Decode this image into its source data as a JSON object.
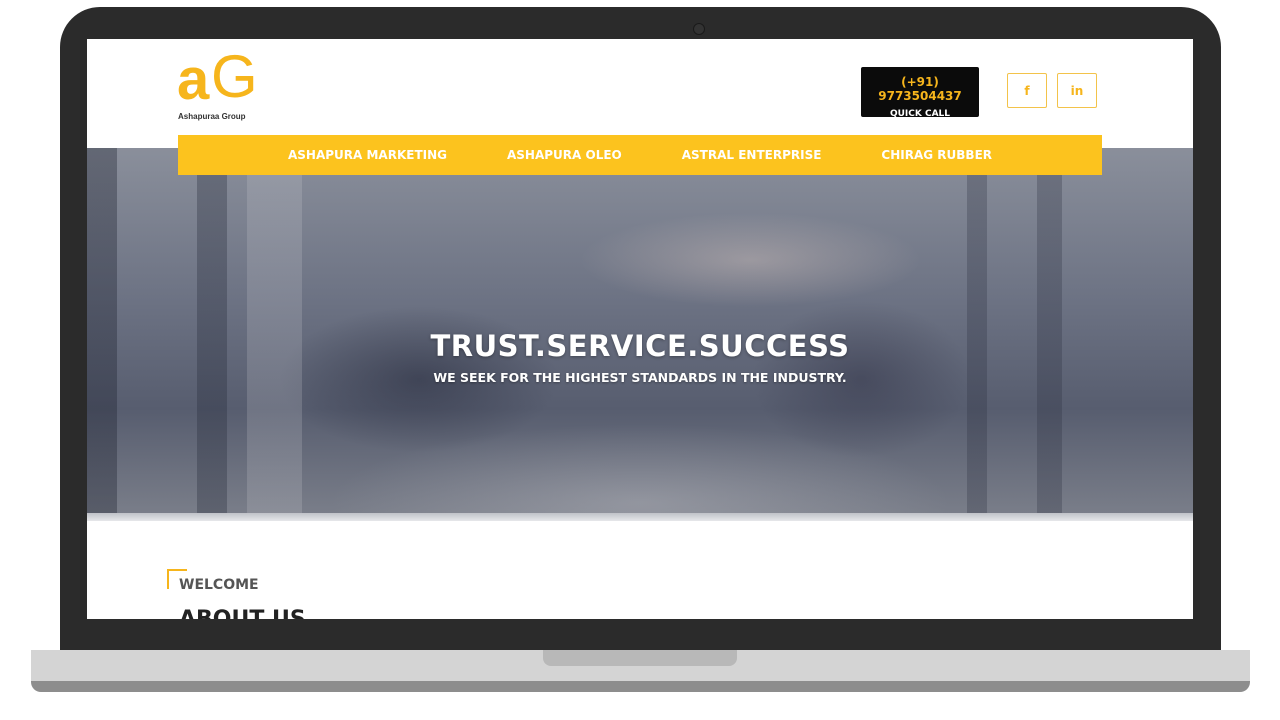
{
  "logo": {
    "mark_a": "a",
    "mark_g": "G",
    "text": "Ashapuraa Group"
  },
  "quick_call": {
    "phone": "(+91) 9773504437",
    "label": "QUICK CALL"
  },
  "social": {
    "facebook": "f",
    "linkedin": "in"
  },
  "nav": [
    "ASHAPURA MARKETING",
    "ASHAPURA OLEO",
    "ASTRAL ENTERPRISE",
    "CHIRAG RUBBER"
  ],
  "hero": {
    "title": "TRUST.SERVICE.SUCCESS",
    "subtitle": "WE SEEK FOR THE HIGHEST STANDARDS IN THE INDUSTRY."
  },
  "about": {
    "kicker": "WELCOME",
    "heading": "ABOUT US"
  },
  "colors": {
    "accent": "#fcc31e",
    "call_bg": "#0b0b0b"
  }
}
